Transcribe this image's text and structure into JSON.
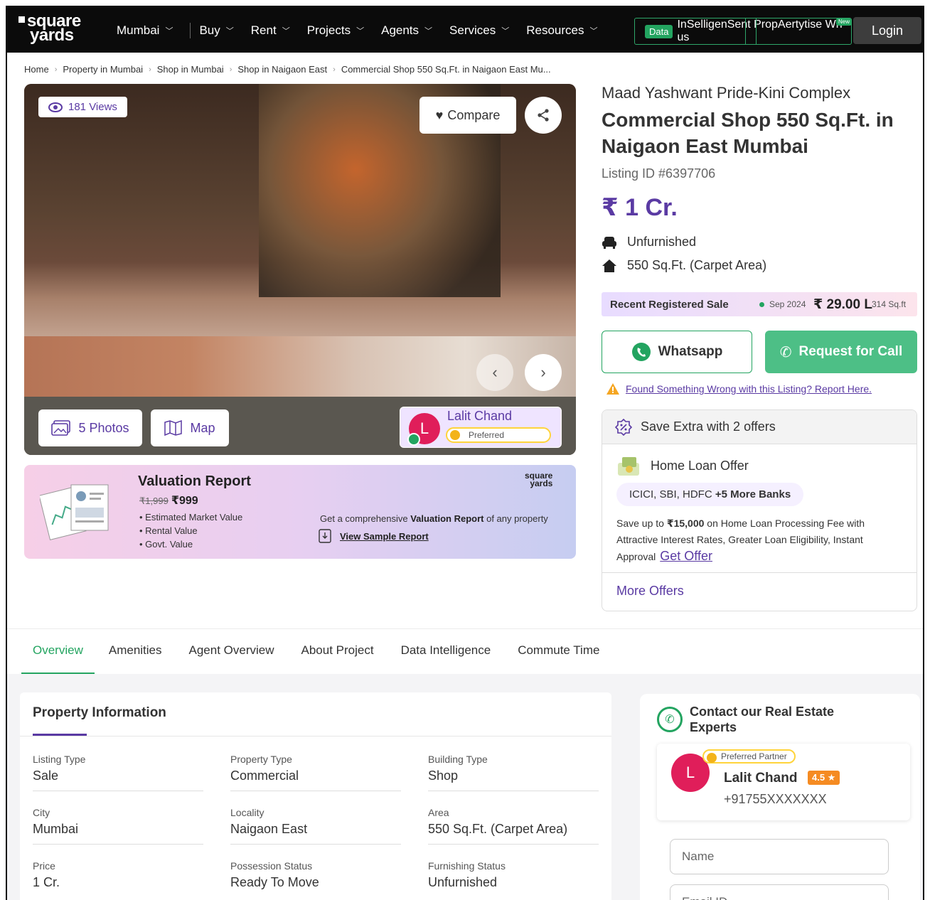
{
  "nav": {
    "logo_line1": "square",
    "logo_line2": "yards",
    "menu": [
      "Mumbai",
      "Buy",
      "Rent",
      "Projects",
      "Agents",
      "Services",
      "Resources"
    ],
    "data_tag": "Data",
    "box_text": "InSelligenSent PropAertytise Wh us",
    "new_badge": "New",
    "login": "Login"
  },
  "breadcrumbs": [
    "Home",
    "Property in Mumbai",
    "Shop in Mumbai",
    "Shop in Naigaon East",
    "Commercial Shop 550 Sq.Ft. in Naigaon East Mu..."
  ],
  "gallery": {
    "views": "181 Views",
    "compare": "Compare",
    "photos": "5 Photos",
    "map": "Map",
    "agent_name": "Lalit Chand",
    "agent_initial": "L",
    "agent_badge": "Preferred"
  },
  "valuation": {
    "title": "Valuation Report",
    "old_price": "₹1,999",
    "price": "₹999",
    "bullets": [
      "Estimated Market Value",
      "Rental Value",
      "Govt. Value"
    ],
    "logo_line1": "square",
    "logo_line2": "yards",
    "desc_pre": "Get a comprehensive ",
    "desc_bold": "Valuation Report",
    "desc_post": " of any property",
    "sample": "View Sample Report"
  },
  "property": {
    "project": "Maad Yashwant Pride-Kini Complex",
    "title": "Commercial Shop 550 Sq.Ft. in Naigaon East Mumbai",
    "listing_id": "Listing ID #6397706",
    "price": "₹ 1 Cr.",
    "furnishing": "Unfurnished",
    "area": "550 Sq.Ft. (Carpet Area)"
  },
  "recent_sale": {
    "label": "Recent Registered Sale",
    "date": "Sep 2024",
    "amount": "₹ 29.00 L",
    "sqft": "314 Sq.ft"
  },
  "actions": {
    "whatsapp": "Whatsapp",
    "call": "Request for Call",
    "report": "Found Something Wrong with this Listing? Report Here."
  },
  "offers": {
    "heading": "Save Extra with 2 offers",
    "loan_title": "Home Loan Offer",
    "banks": "ICICI, SBI, HDFC",
    "banks_more": "+5 More Banks",
    "save_pre": "Save up to ",
    "save_amount": "₹15,000",
    "save_post": " on Home Loan Processing Fee with Attractive Interest Rates, Greater Loan Eligibility, Instant Approval",
    "get_offer": "Get Offer",
    "more": "More Offers"
  },
  "tabs": [
    "Overview",
    "Amenities",
    "Agent Overview",
    "About Project",
    "Data Intelligence",
    "Commute Time"
  ],
  "info": {
    "title": "Property Information",
    "rows": [
      [
        {
          "k": "Listing Type",
          "v": "Sale"
        },
        {
          "k": "Property Type",
          "v": "Commercial"
        },
        {
          "k": "Building Type",
          "v": "Shop"
        }
      ],
      [
        {
          "k": "City",
          "v": "Mumbai"
        },
        {
          "k": "Locality",
          "v": "Naigaon East"
        },
        {
          "k": "Area",
          "v": "550 Sq.Ft. (Carpet Area)"
        }
      ],
      [
        {
          "k": "Price",
          "v": "1 Cr."
        },
        {
          "k": "Possession Status",
          "v": "Ready To Move"
        },
        {
          "k": "Furnishing Status",
          "v": "Unfurnished"
        }
      ]
    ]
  },
  "contact": {
    "title": "Contact our Real Estate Experts",
    "badge": "Preferred Partner",
    "initial": "L",
    "name": "Lalit Chand",
    "rating": "4.5 ★",
    "phone": "+91755XXXXXXX",
    "name_placeholder": "Name",
    "email_placeholder": "Email ID"
  },
  "colors": {
    "brand_purple": "#5a3aa3",
    "green": "#23a460",
    "call_green": "#4dbf86",
    "nav_bg": "#0b0b0b"
  }
}
